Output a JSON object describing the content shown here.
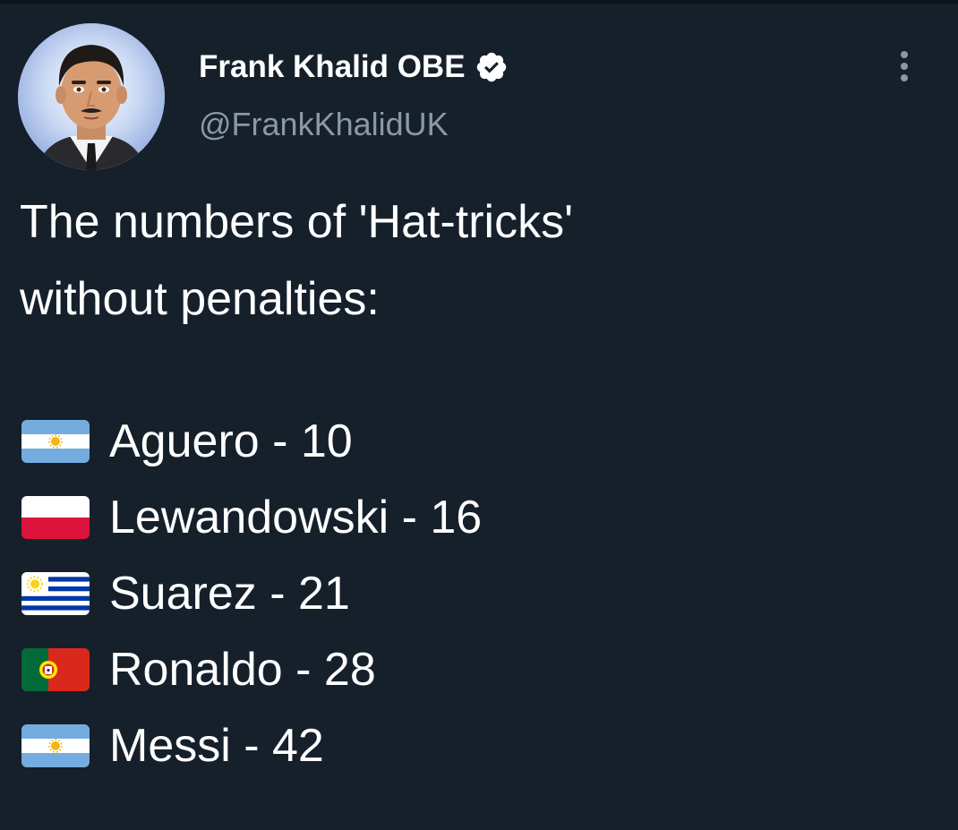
{
  "tweet": {
    "display_name": "Frank Khalid OBE",
    "handle": "@FrankKhalidUK",
    "text_line_1": "The numbers of 'Hat-tricks'",
    "text_line_2": "without penalties:",
    "items": [
      {
        "flag": "argentina-flag-icon",
        "text": "Aguero - 10"
      },
      {
        "flag": "poland-flag-icon",
        "text": "Lewandowski - 16"
      },
      {
        "flag": "uruguay-flag-icon",
        "text": "Suarez - 21"
      },
      {
        "flag": "portugal-flag-icon",
        "text": "Ronaldo - 28"
      },
      {
        "flag": "argentina-flag-icon",
        "text": "Messi - 42"
      }
    ]
  },
  "icons": {
    "verified": "verified-badge-icon",
    "more": "more-options-icon"
  },
  "colors": {
    "background": "#15202b",
    "text_primary": "#ffffff",
    "text_secondary": "#8b98a5"
  }
}
